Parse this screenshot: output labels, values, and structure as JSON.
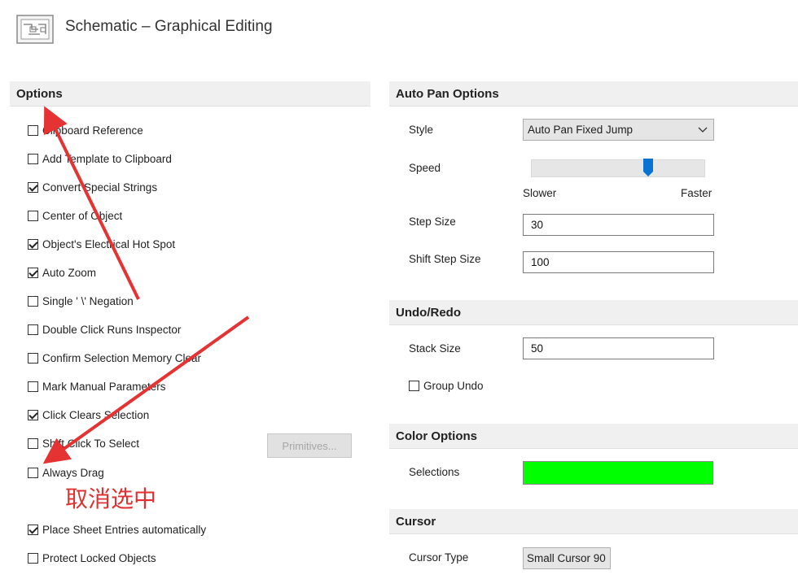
{
  "header": {
    "title": "Schematic – Graphical Editing",
    "icon": "schematic-icon"
  },
  "options": {
    "title": "Options",
    "items": [
      {
        "label": "Clipboard Reference",
        "checked": false
      },
      {
        "label": "Add Template to Clipboard",
        "checked": false
      },
      {
        "label": "Convert Special Strings",
        "checked": true
      },
      {
        "label": "Center of Object",
        "checked": false
      },
      {
        "label": "Object's Electrical Hot Spot",
        "checked": true
      },
      {
        "label": "Auto Zoom",
        "checked": true
      },
      {
        "label": "Single ' \\' Negation",
        "checked": false
      },
      {
        "label": "Double Click Runs Inspector",
        "checked": false
      },
      {
        "label": "Confirm Selection Memory Clear",
        "checked": false
      },
      {
        "label": "Mark Manual Parameters",
        "checked": false
      },
      {
        "label": "Click Clears Selection",
        "checked": true
      },
      {
        "label": "Shift Click To Select",
        "checked": false
      },
      {
        "label": "Always Drag",
        "checked": false
      },
      {
        "label": "Place Sheet Entries automatically",
        "checked": true
      },
      {
        "label": "Protect Locked Objects",
        "checked": false
      }
    ],
    "primitives_label": "Primitives..."
  },
  "annotation": {
    "text": "取消选中",
    "color": "#e03030"
  },
  "auto_pan": {
    "title": "Auto Pan Options",
    "style_label": "Style",
    "style_value": "Auto Pan Fixed Jump",
    "speed_label": "Speed",
    "speed_level": 0.68,
    "slower_label": "Slower",
    "faster_label": "Faster",
    "step_size_label": "Step Size",
    "step_size_value": "30",
    "shift_step_label": "Shift Step Size",
    "shift_step_value": "100"
  },
  "undo": {
    "title": "Undo/Redo",
    "stack_label": "Stack Size",
    "stack_value": "50",
    "group_label": "Group Undo",
    "group_checked": false
  },
  "color_options": {
    "title": "Color Options",
    "selections_label": "Selections",
    "selections_color": "#00ff00"
  },
  "cursor": {
    "title": "Cursor",
    "type_label": "Cursor Type",
    "type_value": "Small Cursor 90"
  }
}
